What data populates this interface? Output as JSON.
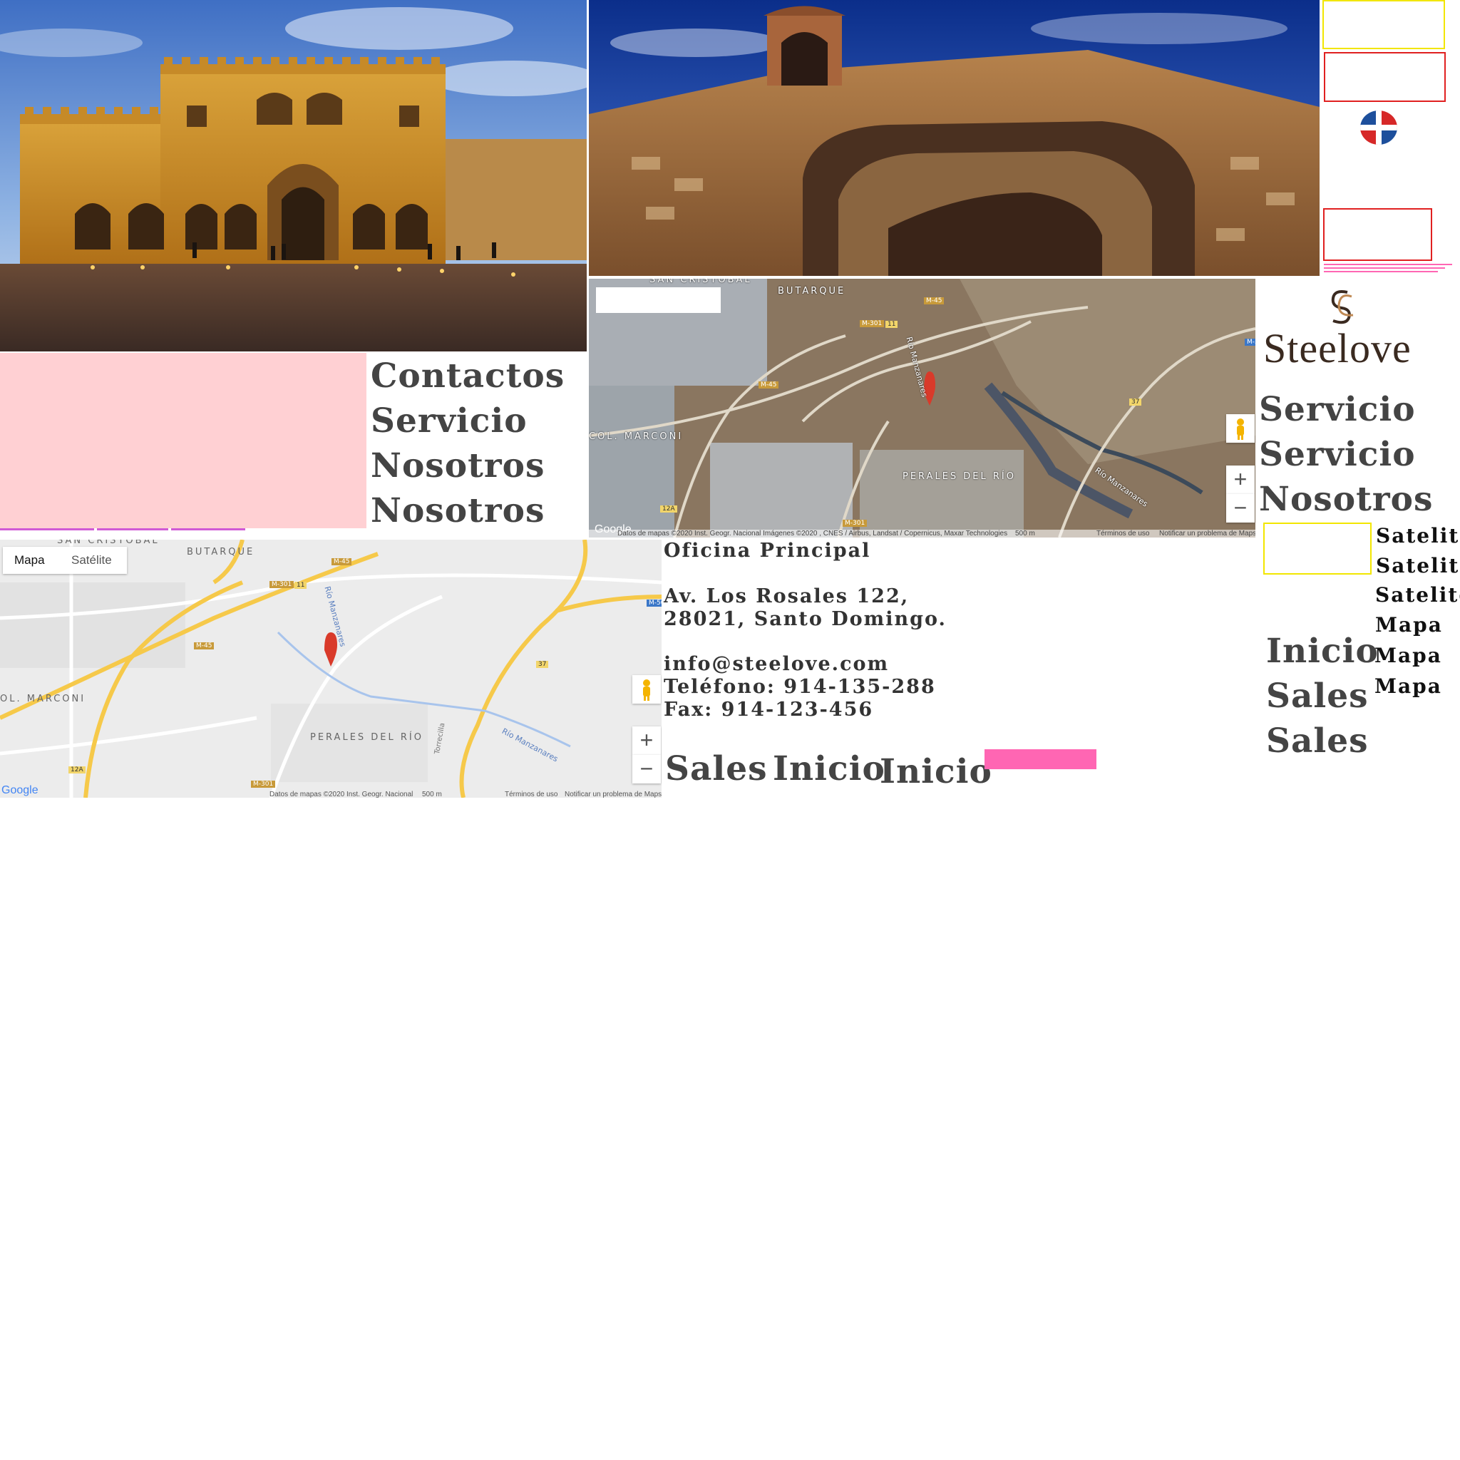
{
  "images": {
    "cathedral": "Catedral de Santo Domingo illuminated at dusk",
    "gate": "Stone gate with bell tower and arch"
  },
  "flag": {
    "icon": "dominican-flag-icon",
    "colors": [
      "#d62828",
      "#1d4f9c",
      "#ffffff"
    ]
  },
  "logo": {
    "text": "Steelove",
    "color": "#3a2a20",
    "accent": "#c08a55"
  },
  "nav_center": [
    "Contactos",
    "Servicio",
    "Nosotros",
    "Nosotros"
  ],
  "nav_right": [
    "Servicio",
    "Servicio",
    "Nosotros"
  ],
  "nav_right_lower": [
    "Inicio",
    "Sales",
    "Sales"
  ],
  "nav_small": [
    "Satelite",
    "Satelite",
    "Satelite",
    "Mapa",
    "Mapa",
    "Mapa"
  ],
  "bottom_nav": [
    "Sales",
    "Inicio",
    "Inicio"
  ],
  "contact": {
    "title": "Oficina Principal",
    "address1": "Av. Los Rosales 122,",
    "address2": "28021, Santo Domingo.",
    "email": "info@steelove.com",
    "phone": "Teléfono: 914-135-288",
    "fax": "Fax: 914-123-456"
  },
  "map_satellite": {
    "labels": {
      "san_cristobal": "SAN CRISTOBAL",
      "butarque": "BUTARQUE",
      "marconi": "COL. MARCONI",
      "perales": "PERALES DEL RÍO",
      "rio1": "Río Manzanares",
      "rio2": "Río Manzanares"
    },
    "roads": [
      "M-45",
      "M-301",
      "11",
      "M-45",
      "M-50",
      "37",
      "12A",
      "M-301"
    ],
    "footer": "Datos de mapas ©2020 Inst. Geogr. Nacional Imágenes ©2020 , CNES / Airbus, Landsat / Copernicus, Maxar Technologies",
    "scale": "500 m",
    "terms": "Términos de uso",
    "report": "Notificar un problema de Maps",
    "google": "Google"
  },
  "map_road": {
    "tab_map": "Mapa",
    "tab_satellite": "Satélite",
    "labels": {
      "san_cristobal": "SAN CRISTOBAL",
      "butarque": "BUTARQUE",
      "marconi": "OL. MARCONI",
      "perales": "PERALES DEL RÍO",
      "rio": "Río Manzanares",
      "rio2": "Río Manzanares",
      "torrecilla": "Torrecilla"
    },
    "roads": [
      "M-45",
      "M-301",
      "11",
      "M-45",
      "M-50",
      "37",
      "12A",
      "M-301"
    ],
    "footer": "Datos de mapas ©2020 Inst. Geogr. Nacional",
    "scale": "500 m",
    "terms": "Términos de uso",
    "report": "Notificar un problema de Maps",
    "google": "Google"
  },
  "colors": {
    "pink_block": "#ffd0d3",
    "hot_pink": "#ff66b3",
    "yellow_outline": "#f2e600",
    "red_outline": "#e02020",
    "nav_text": "#444444"
  }
}
